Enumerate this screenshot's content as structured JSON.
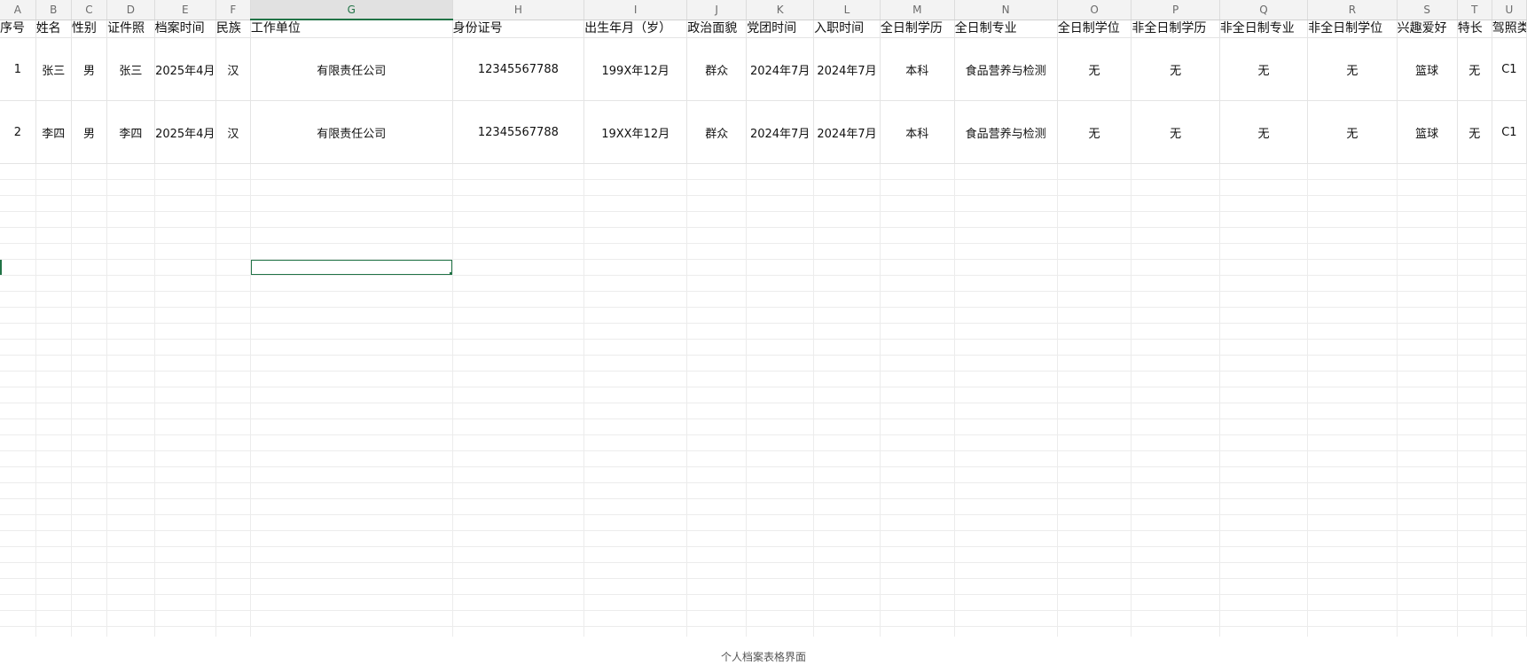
{
  "columns": [
    {
      "letter": "A",
      "header": "序号",
      "name": "index"
    },
    {
      "letter": "B",
      "header": "姓名",
      "name": "name"
    },
    {
      "letter": "C",
      "header": "性别",
      "name": "gender"
    },
    {
      "letter": "D",
      "header": "证件照",
      "name": "photo"
    },
    {
      "letter": "E",
      "header": "档案时间",
      "name": "archive-time"
    },
    {
      "letter": "F",
      "header": "民族",
      "name": "ethnicity"
    },
    {
      "letter": "G",
      "header": "工作单位",
      "name": "work-unit"
    },
    {
      "letter": "H",
      "header": "身份证号",
      "name": "id-number"
    },
    {
      "letter": "I",
      "header": "出生年月（岁）",
      "name": "birth"
    },
    {
      "letter": "J",
      "header": "政治面貌",
      "name": "political-status"
    },
    {
      "letter": "K",
      "header": "党团时间",
      "name": "party-time"
    },
    {
      "letter": "L",
      "header": "入职时间",
      "name": "hire-time"
    },
    {
      "letter": "M",
      "header": "全日制学历",
      "name": "ft-education"
    },
    {
      "letter": "N",
      "header": "全日制专业",
      "name": "ft-major"
    },
    {
      "letter": "O",
      "header": "全日制学位",
      "name": "ft-degree"
    },
    {
      "letter": "P",
      "header": "非全日制学历",
      "name": "pt-education"
    },
    {
      "letter": "Q",
      "header": "非全日制专业",
      "name": "pt-major"
    },
    {
      "letter": "R",
      "header": "非全日制学位",
      "name": "pt-degree"
    },
    {
      "letter": "S",
      "header": "兴趣爱好",
      "name": "hobby"
    },
    {
      "letter": "T",
      "header": "特长",
      "name": "specialty"
    },
    {
      "letter": "U",
      "header": "驾照类型",
      "name": "license-type"
    }
  ],
  "rows": [
    [
      "1",
      "张三",
      "男",
      "张三",
      "2025年4月",
      "汉",
      "有限责任公司",
      "12345567788",
      "199X年12月",
      "群众",
      "2024年7月",
      "2024年7月",
      "本科",
      "食品营养与检测",
      "无",
      "无",
      "无",
      "无",
      "篮球",
      "无",
      "C1"
    ],
    [
      "2",
      "李四",
      "男",
      "李四",
      "2025年4月",
      "汉",
      "有限责任公司",
      "12345567788",
      "19XX年12月",
      "群众",
      "2024年7月",
      "2024年7月",
      "本科",
      "食品营养与检测",
      "无",
      "无",
      "无",
      "无",
      "篮球",
      "无",
      "C1"
    ]
  ],
  "selection": {
    "column": "G"
  },
  "caption": "个人档案表格界面",
  "colors": {
    "accent": "#217346"
  }
}
